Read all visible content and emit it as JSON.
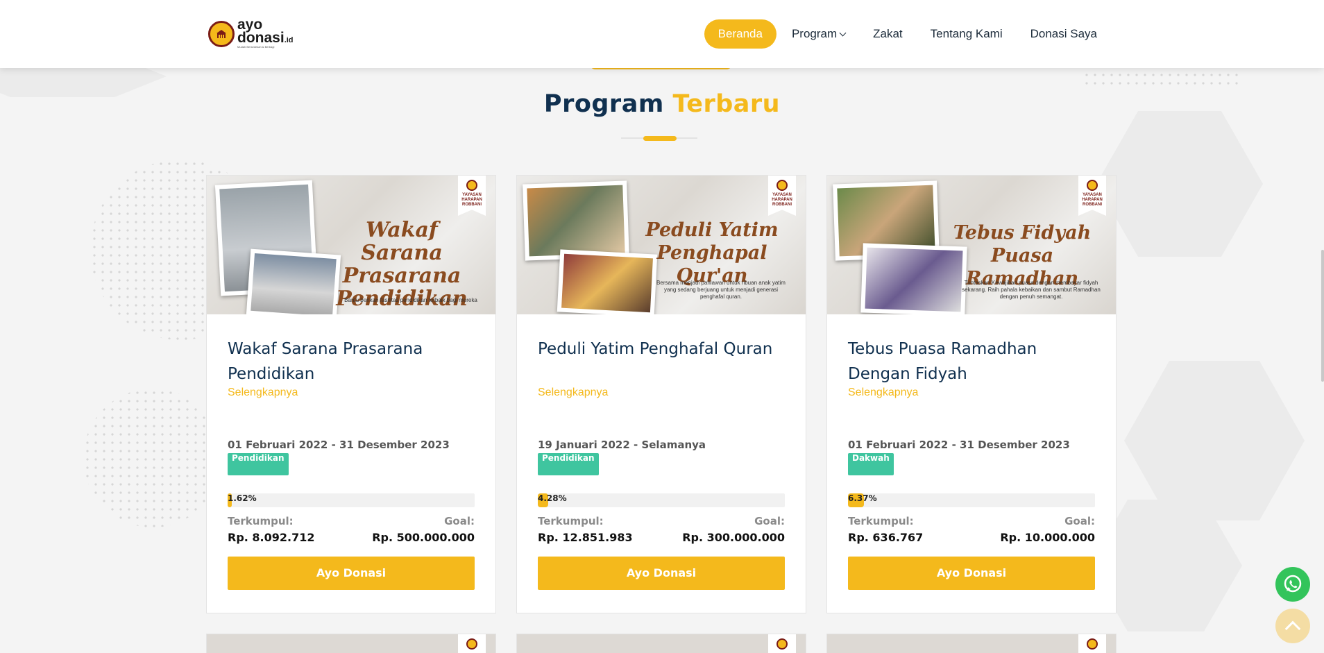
{
  "brand": {
    "logo_line1": "ayo",
    "logo_line2": "donasi",
    "logo_suffix": ".id",
    "tagline": "Mudah Bersedekah & Berbagi",
    "logo_icon": "mosque-icon"
  },
  "nav": {
    "items": [
      {
        "label": "Beranda",
        "active": true
      },
      {
        "label": "Program",
        "has_dropdown": true
      },
      {
        "label": "Zakat"
      },
      {
        "label": "Tentang Kami"
      },
      {
        "label": "Donasi Saya"
      }
    ]
  },
  "section": {
    "title_part1": "Program",
    "title_part2": "Terbaru"
  },
  "colors": {
    "accent": "#f4b91c",
    "navy": "#10304f",
    "category": "#3fc59f",
    "whatsapp": "#33c45b"
  },
  "cards": [
    {
      "image_title": "Wakaf Sarana Prasarana Pendidikan",
      "image_caption": "Bantu berikan fasilitas pendidikan terbaik bagi mereka",
      "image_badge": "YAYASAN HARAPAN ROBBANI",
      "title": "Wakaf Sarana Prasarana Pendidikan",
      "more": "Selengkapnya",
      "date": "01 Februari 2022 - 31 Desember 2023",
      "category": "Pendidikan",
      "progress_label": "1.62%",
      "progress": 0.0162,
      "collected_label": "Terkumpul:",
      "goal_label": "Goal:",
      "collected": "Rp. 8.092.712",
      "goal": "Rp. 500.000.000",
      "cta": "Ayo Donasi"
    },
    {
      "image_title": "Peduli Yatim Penghapal Qur'an",
      "image_caption": "Bersama menjadi pahlawan untuk ribuan anak yatim yang sedang berjuang untuk menjadi generasi penghafal quran.",
      "image_badge": "YAYASAN HARAPAN ROBBANI",
      "title": "Peduli Yatim Penghafal Quran",
      "more": "Selengkapnya",
      "date": "19 Januari 2022 - Selamanya",
      "category": "Pendidikan",
      "progress_label": "4.28%",
      "progress": 0.0428,
      "collected_label": "Terkumpul:",
      "goal_label": "Goal:",
      "collected": "Rp. 12.851.983",
      "goal": "Rp. 300.000.000",
      "cta": "Ayo Donasi"
    },
    {
      "image_title": "Tebus Fidyah Puasa Ramadhan",
      "image_caption": "Tuntaskan Kewajiban puasa dengan membayar fidyah sekarang. Raih pahala kebaikan dan sambut Ramadhan dengan penuh semangat.",
      "image_badge": "YAYASAN HARAPAN ROBBANI",
      "title": "Tebus Puasa Ramadhan Dengan Fidyah",
      "more": "Selengkapnya",
      "date": "01 Februari 2022 - 31 Desember 2023",
      "category": "Dakwah",
      "progress_label": "6.37%",
      "progress": 0.0637,
      "collected_label": "Terkumpul:",
      "goal_label": "Goal:",
      "collected": "Rp. 636.767",
      "goal": "Rp. 10.000.000",
      "cta": "Ayo Donasi"
    }
  ],
  "floating": {
    "whatsapp_icon": "whatsapp-icon",
    "back_to_top_icon": "chevron-up-icon"
  }
}
